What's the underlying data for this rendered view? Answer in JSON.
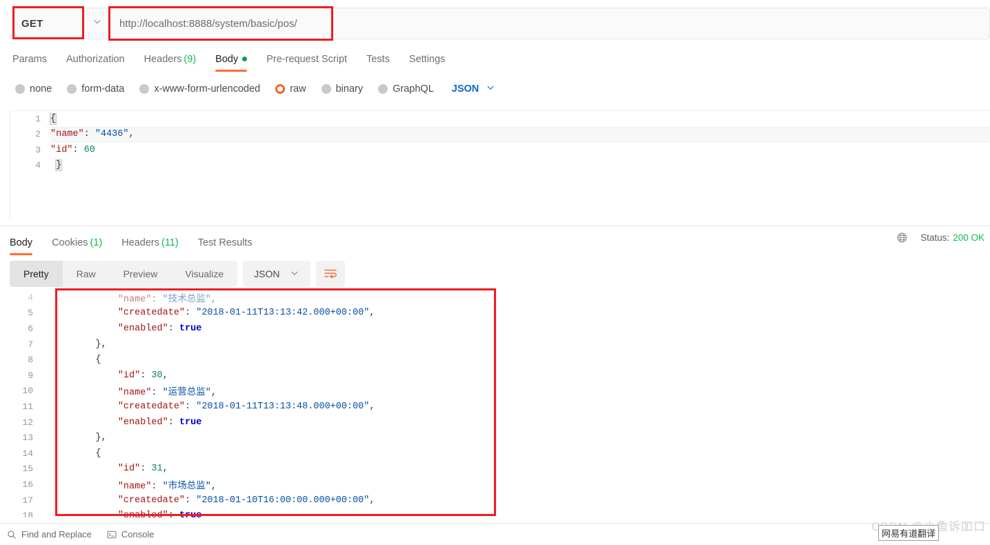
{
  "request": {
    "method": "GET",
    "method_caret": "chevron-down",
    "url": "http://localhost:8888/system/basic/pos/",
    "tabs": [
      {
        "label": "Params",
        "count": "",
        "dot": false,
        "active": false
      },
      {
        "label": "Authorization",
        "count": "",
        "dot": false,
        "active": false
      },
      {
        "label": "Headers",
        "count": "(9)",
        "dot": false,
        "active": false
      },
      {
        "label": "Body",
        "count": "",
        "dot": true,
        "active": true
      },
      {
        "label": "Pre-request Script",
        "count": "",
        "dot": false,
        "active": false
      },
      {
        "label": "Tests",
        "count": "",
        "dot": false,
        "active": false
      },
      {
        "label": "Settings",
        "count": "",
        "dot": false,
        "active": false
      }
    ],
    "body_types": [
      {
        "label": "none",
        "selected": false
      },
      {
        "label": "form-data",
        "selected": false
      },
      {
        "label": "x-www-form-urlencoded",
        "selected": false
      },
      {
        "label": "raw",
        "selected": true
      },
      {
        "label": "binary",
        "selected": false
      },
      {
        "label": "GraphQL",
        "selected": false
      }
    ],
    "format": "JSON",
    "format_caret": "chevron-down",
    "body_lines": [
      {
        "n": "1",
        "tokens": [
          {
            "t": "{",
            "c": "brace-hl p"
          }
        ]
      },
      {
        "n": "2",
        "tokens": [
          {
            "t": "\"name\"",
            "c": "k"
          },
          {
            "t": ":",
            "c": "p"
          },
          {
            "t": " ",
            "c": "dotspc"
          },
          {
            "t": "\"4436\"",
            "c": "s"
          },
          {
            "t": ",",
            "c": "p"
          }
        ],
        "highlight": true
      },
      {
        "n": "3",
        "tokens": [
          {
            "t": "\"id\"",
            "c": "k"
          },
          {
            "t": ":",
            "c": "p"
          },
          {
            "t": " ",
            "c": "dotspc"
          },
          {
            "t": "60",
            "c": "n"
          }
        ]
      },
      {
        "n": "4",
        "tokens": [
          {
            "t": " ",
            "c": "dotspc"
          },
          {
            "t": "}",
            "c": "brace-hl p"
          }
        ]
      }
    ]
  },
  "response": {
    "tabs": [
      {
        "label": "Body",
        "count": "",
        "active": true
      },
      {
        "label": "Cookies",
        "count": "(1)",
        "active": false
      },
      {
        "label": "Headers",
        "count": "(11)",
        "active": false
      },
      {
        "label": "Test Results",
        "count": "",
        "active": false
      }
    ],
    "status_label": "Status:",
    "status_value": "200 OK",
    "globe_icon": "globe-icon",
    "view_modes": [
      {
        "label": "Pretty",
        "active": true
      },
      {
        "label": "Raw",
        "active": false
      },
      {
        "label": "Preview",
        "active": false
      },
      {
        "label": "Visualize",
        "active": false
      }
    ],
    "format": "JSON",
    "wrap_icon": "wrap-lines-icon",
    "body_lines": [
      {
        "n": "4",
        "partial": true,
        "tokens": [
          {
            "t": "        ",
            "c": "p"
          },
          {
            "t": "\"name\"",
            "c": "k"
          },
          {
            "t": ": ",
            "c": "p"
          },
          {
            "t": "\"技术总监\"",
            "c": "s"
          },
          {
            "t": ",",
            "c": "p"
          }
        ]
      },
      {
        "n": "5",
        "tokens": [
          {
            "t": "        ",
            "c": "p"
          },
          {
            "t": "\"createdate\"",
            "c": "k"
          },
          {
            "t": ": ",
            "c": "p"
          },
          {
            "t": "\"2018-01-11T13:13:42.000+00:00\"",
            "c": "s"
          },
          {
            "t": ",",
            "c": "p"
          }
        ]
      },
      {
        "n": "6",
        "tokens": [
          {
            "t": "        ",
            "c": "p"
          },
          {
            "t": "\"enabled\"",
            "c": "k"
          },
          {
            "t": ": ",
            "c": "p"
          },
          {
            "t": "true",
            "c": "b"
          }
        ]
      },
      {
        "n": "7",
        "tokens": [
          {
            "t": "    ",
            "c": "p"
          },
          {
            "t": "}",
            "c": "p"
          },
          {
            "t": ",",
            "c": "p"
          }
        ]
      },
      {
        "n": "8",
        "tokens": [
          {
            "t": "    ",
            "c": "p"
          },
          {
            "t": "{",
            "c": "p"
          }
        ]
      },
      {
        "n": "9",
        "tokens": [
          {
            "t": "        ",
            "c": "p"
          },
          {
            "t": "\"id\"",
            "c": "k"
          },
          {
            "t": ": ",
            "c": "p"
          },
          {
            "t": "30",
            "c": "n"
          },
          {
            "t": ",",
            "c": "p"
          }
        ]
      },
      {
        "n": "10",
        "tokens": [
          {
            "t": "        ",
            "c": "p"
          },
          {
            "t": "\"name\"",
            "c": "k"
          },
          {
            "t": ": ",
            "c": "p"
          },
          {
            "t": "\"运营总监\"",
            "c": "s"
          },
          {
            "t": ",",
            "c": "p"
          }
        ]
      },
      {
        "n": "11",
        "tokens": [
          {
            "t": "        ",
            "c": "p"
          },
          {
            "t": "\"createdate\"",
            "c": "k"
          },
          {
            "t": ": ",
            "c": "p"
          },
          {
            "t": "\"2018-01-11T13:13:48.000+00:00\"",
            "c": "s"
          },
          {
            "t": ",",
            "c": "p"
          }
        ]
      },
      {
        "n": "12",
        "tokens": [
          {
            "t": "        ",
            "c": "p"
          },
          {
            "t": "\"enabled\"",
            "c": "k"
          },
          {
            "t": ": ",
            "c": "p"
          },
          {
            "t": "true",
            "c": "b"
          }
        ]
      },
      {
        "n": "13",
        "tokens": [
          {
            "t": "    ",
            "c": "p"
          },
          {
            "t": "}",
            "c": "p"
          },
          {
            "t": ",",
            "c": "p"
          }
        ]
      },
      {
        "n": "14",
        "tokens": [
          {
            "t": "    ",
            "c": "p"
          },
          {
            "t": "{",
            "c": "p"
          }
        ]
      },
      {
        "n": "15",
        "tokens": [
          {
            "t": "        ",
            "c": "p"
          },
          {
            "t": "\"id\"",
            "c": "k"
          },
          {
            "t": ": ",
            "c": "p"
          },
          {
            "t": "31",
            "c": "n"
          },
          {
            "t": ",",
            "c": "p"
          }
        ]
      },
      {
        "n": "16",
        "tokens": [
          {
            "t": "        ",
            "c": "p"
          },
          {
            "t": "\"name\"",
            "c": "k"
          },
          {
            "t": ": ",
            "c": "p"
          },
          {
            "t": "\"市场总监\"",
            "c": "s"
          },
          {
            "t": ",",
            "c": "p"
          }
        ]
      },
      {
        "n": "17",
        "tokens": [
          {
            "t": "        ",
            "c": "p"
          },
          {
            "t": "\"createdate\"",
            "c": "k"
          },
          {
            "t": ": ",
            "c": "p"
          },
          {
            "t": "\"2018-01-10T16:00:00.000+00:00\"",
            "c": "s"
          },
          {
            "t": ",",
            "c": "p"
          }
        ]
      },
      {
        "n": "18",
        "tokens": [
          {
            "t": "        ",
            "c": "p"
          },
          {
            "t": "\"enabled\"",
            "c": "k"
          },
          {
            "t": ": ",
            "c": "p"
          },
          {
            "t": "true",
            "c": "b"
          }
        ]
      }
    ]
  },
  "footer": {
    "find_replace": "Find and Replace",
    "console": "Console"
  },
  "overlay": {
    "watermark": "CSDN @小鱼诉吅口",
    "translate_chip": "网易有道翻译"
  },
  "colors": {
    "accent": "#ff6c37",
    "annotation": "#ef1c23",
    "success": "#0cbb52",
    "link": "#0b6bcb"
  }
}
